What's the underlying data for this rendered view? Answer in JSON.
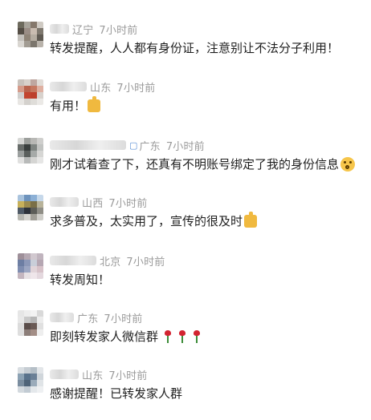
{
  "comments": [
    {
      "location": "辽宁",
      "time": "7小时前",
      "text": "转发提醒，人人都有身份证，注意别让不法分子利用！",
      "emoji": "",
      "has_vip_badge": false,
      "avatar_colors": [
        "#6d6a5d",
        "#a7a39a",
        "#85786b",
        "#cfcac3",
        "#544d45",
        "#9a8d85",
        "#c9bcb0",
        "#7e786e",
        "#c3c0bb",
        "#8f8477",
        "#b4aca0",
        "#5f5a52",
        "#d9d6d1",
        "#a29c93",
        "#7c766d",
        "#b9b3ab"
      ]
    },
    {
      "location": "山东",
      "time": "7小时前",
      "text": "有用！",
      "emoji": "thumbs-up",
      "has_vip_badge": false,
      "avatar_colors": [
        "#c9c2bc",
        "#d8d1cb",
        "#bfa7a0",
        "#e1dcd7",
        "#d59b8a",
        "#b9644e",
        "#c67860",
        "#dfb0a1",
        "#d1cfcd",
        "#c3452f",
        "#bd3f2c",
        "#d8d2cd",
        "#e8e6e3",
        "#d4d1cd",
        "#dfddd9",
        "#ebe9e6"
      ]
    },
    {
      "location": "广东",
      "time": "7小时前",
      "text": "刚才试着查了下，还真有不明账号绑定了我的身份信息",
      "emoji": "surprised-face",
      "has_vip_badge": true,
      "avatar_colors": [
        "#d6d7d5",
        "#9c9f9c",
        "#b8b8b5",
        "#cfcfcd",
        "#676c6a",
        "#383e3d",
        "#7f8582",
        "#c1c3c1",
        "#9b9f9e",
        "#5a5f5d",
        "#a6aaa8",
        "#d6d6d4",
        "#e0e0df",
        "#b8bab9",
        "#d5d5d3",
        "#e6e6e5"
      ]
    },
    {
      "location": "山西",
      "time": "7小时前",
      "text": "求多普及，太实用了，宣传的很及时",
      "emoji": "thumbs-up",
      "has_vip_badge": false,
      "avatar_colors": [
        "#a9c3dd",
        "#6e93bd",
        "#8cb0d6",
        "#c6d8ea",
        "#c7b05a",
        "#9c8b4e",
        "#7a6f47",
        "#b8b39a",
        "#4f5a66",
        "#2e333a",
        "#5c5d58",
        "#8f8e86",
        "#b8b8b1",
        "#d5d4ce",
        "#a19f97",
        "#cfcec9"
      ]
    },
    {
      "location": "北京",
      "time": "7小时前",
      "text": "转发周知！",
      "emoji": "",
      "has_vip_badge": false,
      "avatar_colors": [
        "#9e8f99",
        "#b5a8b2",
        "#d1c8cf",
        "#c0b4be",
        "#6d7ea3",
        "#8c98b8",
        "#c9ced9",
        "#b6a7b3",
        "#7f8db0",
        "#9ca6c2",
        "#e1d4d9",
        "#d7c2c9",
        "#c4b6bf",
        "#e7e1e4",
        "#efe6ea",
        "#e4d8de"
      ]
    },
    {
      "location": "广东",
      "time": "7小时前",
      "text": "即刻转发家人微信群",
      "emoji": "roses",
      "has_vip_badge": false,
      "avatar_colors": [
        "#e6e6e6",
        "#eeeeee",
        "#f3f3f3",
        "#d9d9d9",
        "#e8e8e8",
        "#c9c9c9",
        "#b7b7b7",
        "#ececec",
        "#dcdcdc",
        "#5a4d4a",
        "#6a5a55",
        "#e0e0e0",
        "#dedede",
        "#8c7e79",
        "#a38e86",
        "#eeeeee"
      ]
    },
    {
      "location": "山东",
      "time": "7小时前",
      "text": "感谢提醒！已转发家人群",
      "emoji": "",
      "has_vip_badge": false,
      "avatar_colors": [
        "#d9dee2",
        "#c6cdd3",
        "#b5bfc7",
        "#e3e6e9",
        "#8ca2b4",
        "#59728b",
        "#6b8096",
        "#d0d6db",
        "#7a8d9f",
        "#4e6378",
        "#9aabba",
        "#e0e4e7",
        "#d3d9de",
        "#c2cbd3",
        "#e4e8eb",
        "#eef0f2"
      ]
    }
  ]
}
